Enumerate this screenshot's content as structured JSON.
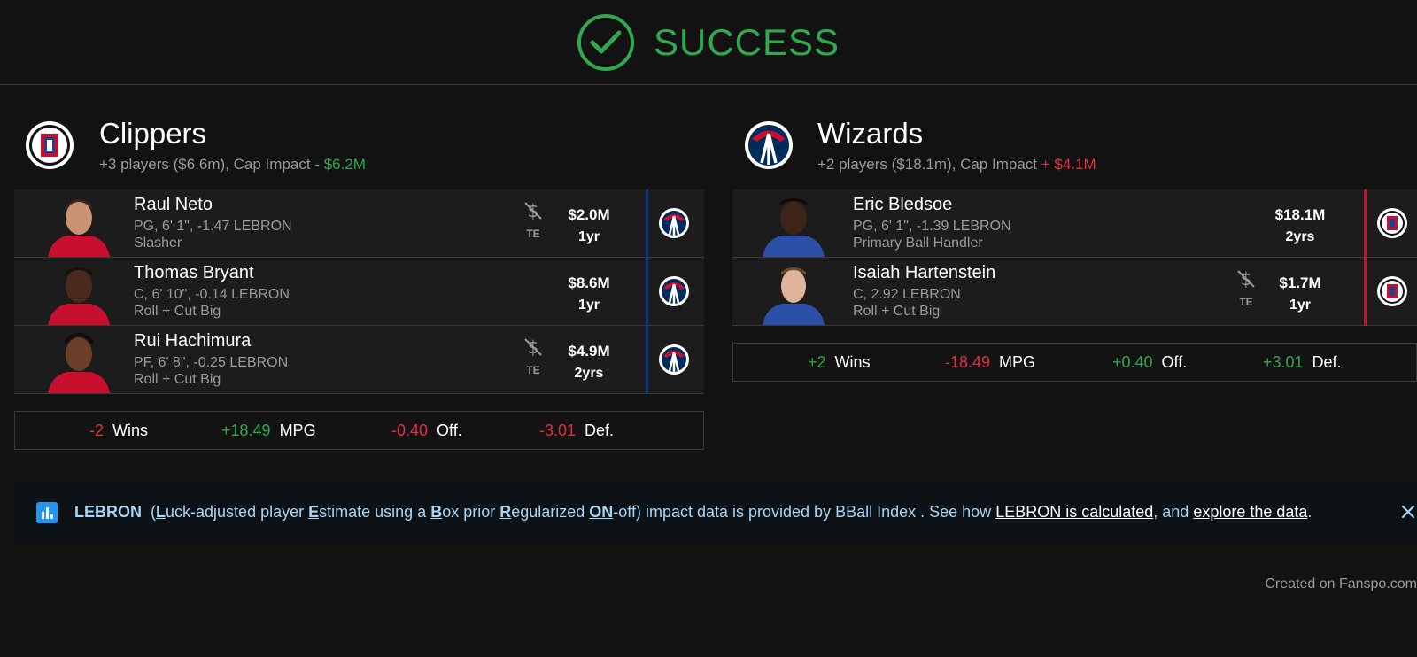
{
  "header": {
    "title": "SUCCESS"
  },
  "teams": [
    {
      "name": "Clippers",
      "summary": "+3 players ($6.6m), Cap Impact",
      "cap_impact": "- $6.2M",
      "players": [
        {
          "name": "Raul Neto",
          "line1": "PG, 6' 1\", -1.47 LEBRON",
          "line2": "Slasher",
          "te": "TE",
          "amount": "$2.0M",
          "years": "1yr"
        },
        {
          "name": "Thomas Bryant",
          "line1": "C, 6' 10\", -0.14 LEBRON",
          "line2": "Roll + Cut Big",
          "amount": "$8.6M",
          "years": "1yr"
        },
        {
          "name": "Rui Hachimura",
          "line1": "PF, 6' 8\", -0.25 LEBRON",
          "line2": "Roll + Cut Big",
          "te": "TE",
          "amount": "$4.9M",
          "years": "2yrs"
        }
      ],
      "stats": [
        {
          "value": "-2",
          "label": "Wins"
        },
        {
          "value": "+18.49",
          "label": "MPG"
        },
        {
          "value": "-0.40",
          "label": "Off."
        },
        {
          "value": "-3.01",
          "label": "Def."
        }
      ]
    },
    {
      "name": "Wizards",
      "summary": "+2 players ($18.1m), Cap Impact",
      "cap_impact": "+ $4.1M",
      "players": [
        {
          "name": "Eric Bledsoe",
          "line1": "PG, 6' 1\", -1.39 LEBRON",
          "line2": "Primary Ball Handler",
          "amount": "$18.1M",
          "years": "2yrs"
        },
        {
          "name": "Isaiah Hartenstein",
          "line1": "C, 2.92 LEBRON",
          "line2": "Roll + Cut Big",
          "te": "TE",
          "amount": "$1.7M",
          "years": "1yr"
        }
      ],
      "stats": [
        {
          "value": "+2",
          "label": "Wins"
        },
        {
          "value": "-18.49",
          "label": "MPG"
        },
        {
          "value": "+0.40",
          "label": "Off."
        },
        {
          "value": "+3.01",
          "label": "Def."
        }
      ]
    }
  ],
  "info_bar": {
    "lebron": "LEBRON",
    "paren_open": "(",
    "L": "L",
    "t1": "uck-adjusted player ",
    "E": "E",
    "t2": "stimate using a ",
    "B": "B",
    "t3": "ox prior ",
    "R": "R",
    "t4": "egularized ",
    "ON": "ON",
    "t5": "-off) impact data is provided by BBall Index . See how ",
    "link1": "LEBRON is calculated",
    "t6": ", and ",
    "link2": "explore the data",
    "t7": "."
  },
  "footer": "Created on Fanspo.com",
  "colors": {
    "success": "#2fa84f",
    "negative": "#e03040",
    "clippers_divider": "#0b3b8a",
    "wizards_divider": "#c8102e"
  }
}
